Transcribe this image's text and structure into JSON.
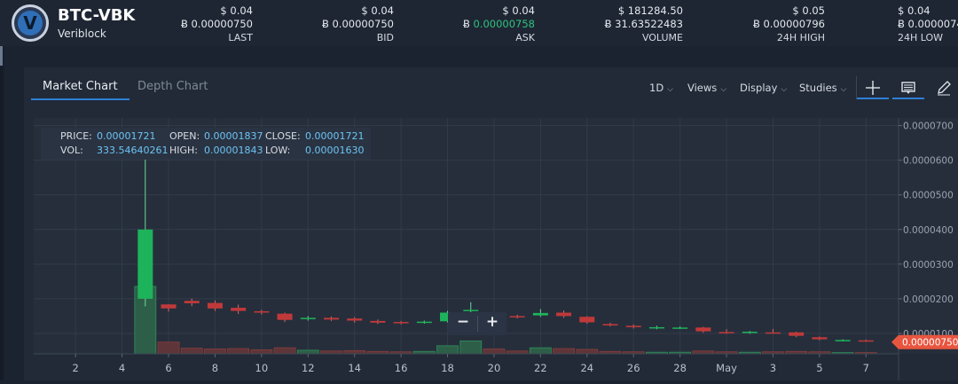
{
  "market": {
    "pair": "BTC-VBK",
    "name": "Veriblock",
    "stats": [
      {
        "usd": "$ 0.04",
        "btc": "0.00000750",
        "label": "LAST",
        "highlight": false
      },
      {
        "usd": "$ 0.04",
        "btc": "0.00000750",
        "label": "BID",
        "highlight": false
      },
      {
        "usd": "$ 0.04",
        "btc": "0.00000758",
        "label": "ASK",
        "highlight": true
      },
      {
        "usd": "$ 181284.50",
        "btc": "31.63522483",
        "label": "VOLUME",
        "highlight": false
      },
      {
        "usd": "$ 0.05",
        "btc": "0.00000796",
        "label": "24H HIGH",
        "highlight": false
      },
      {
        "usd": "$ 0.04",
        "btc": "0.0000074",
        "label": "24H LOW",
        "highlight": false
      }
    ],
    "btc_symbol": "Ƀ"
  },
  "tabs": {
    "market_chart": "Market Chart",
    "depth_chart": "Depth Chart"
  },
  "controls": {
    "interval": "1D",
    "views": "Views",
    "display": "Display",
    "studies": "Studies"
  },
  "icons": {
    "logo": "veriblock-logo-icon",
    "crosshair": "crosshair-icon",
    "indicator": "indicator-panel-icon",
    "draw": "pencil-icon",
    "chevron": "chevron-down-icon",
    "zoom_out": "minus-icon",
    "zoom_in": "plus-icon"
  },
  "zoom": {
    "minus": "−",
    "plus": "+"
  },
  "legend": {
    "price_label": "PRICE:",
    "price": "0.00001721",
    "open_label": "OPEN:",
    "open": "0.00001837",
    "close_label": "CLOSE:",
    "close": "0.00001721",
    "vol_label": "VOL:",
    "vol": "333.54640261",
    "high_label": "HIGH:",
    "high": "0.00001843",
    "low_label": "LOW:",
    "low": "0.00001630"
  },
  "colors": {
    "up": "#1db35a",
    "down": "#c0393a",
    "price_tag": "#e8553f",
    "accent": "#2f7fd6"
  },
  "chart_data": {
    "type": "candlestick",
    "x_ticks": [
      "2",
      "4",
      "6",
      "8",
      "10",
      "12",
      "14",
      "16",
      "18",
      "20",
      "22",
      "24",
      "26",
      "28",
      "May",
      "3",
      "5",
      "7"
    ],
    "x_tick_pos": [
      2,
      4,
      6,
      8,
      10,
      12,
      14,
      16,
      18,
      20,
      22,
      24,
      26,
      28,
      30,
      32,
      34,
      36
    ],
    "x_range": [
      0.2,
      37.4
    ],
    "y_ticks": [
      "0.0000700",
      "0.0000600",
      "0.0000500",
      "0.0000400",
      "0.0000300",
      "0.0000200",
      "0.0000100"
    ],
    "y_tick_values": [
      7e-05,
      6e-05,
      5e-05,
      4e-05,
      3e-05,
      2e-05,
      1e-05
    ],
    "y_range": [
      4.1e-06,
      7.22e-05
    ],
    "last_price": "0.00000750",
    "last_price_value": 7.5e-06,
    "volume_max": 333.55,
    "candles": [
      {
        "x": 5,
        "open": 2e-05,
        "close": 4e-05,
        "high": 6.7e-05,
        "low": 1.78e-05
      },
      {
        "x": 6,
        "open": 1.837e-05,
        "close": 1.721e-05,
        "high": 1.843e-05,
        "low": 1.63e-05
      },
      {
        "x": 7,
        "open": 1.94e-05,
        "close": 1.87e-05,
        "high": 2.01e-05,
        "low": 1.79e-05
      },
      {
        "x": 8,
        "open": 1.88e-05,
        "close": 1.72e-05,
        "high": 1.95e-05,
        "low": 1.65e-05
      },
      {
        "x": 9,
        "open": 1.74e-05,
        "close": 1.65e-05,
        "high": 1.83e-05,
        "low": 1.56e-05
      },
      {
        "x": 10,
        "open": 1.64e-05,
        "close": 1.6e-05,
        "high": 1.68e-05,
        "low": 1.55e-05
      },
      {
        "x": 11,
        "open": 1.57e-05,
        "close": 1.39e-05,
        "high": 1.6e-05,
        "low": 1.33e-05
      },
      {
        "x": 12,
        "open": 1.43e-05,
        "close": 1.45e-05,
        "high": 1.5e-05,
        "low": 1.37e-05
      },
      {
        "x": 13,
        "open": 1.45e-05,
        "close": 1.4e-05,
        "high": 1.49e-05,
        "low": 1.36e-05
      },
      {
        "x": 14,
        "open": 1.43e-05,
        "close": 1.37e-05,
        "high": 1.47e-05,
        "low": 1.31e-05
      },
      {
        "x": 15,
        "open": 1.36e-05,
        "close": 1.31e-05,
        "high": 1.4e-05,
        "low": 1.27e-05
      },
      {
        "x": 16,
        "open": 1.33e-05,
        "close": 1.3e-05,
        "high": 1.36e-05,
        "low": 1.26e-05
      },
      {
        "x": 17,
        "open": 1.31e-05,
        "close": 1.34e-05,
        "high": 1.37e-05,
        "low": 1.28e-05
      },
      {
        "x": 18,
        "open": 1.35e-05,
        "close": 1.6e-05,
        "high": 1.65e-05,
        "low": 1.32e-05
      },
      {
        "x": 19,
        "open": 1.65e-05,
        "close": 1.68e-05,
        "high": 1.9e-05,
        "low": 1.6e-05
      },
      {
        "x": 20,
        "open": 1.5e-05,
        "close": 1.52e-05,
        "high": 1.58e-05,
        "low": 1.4e-05
      },
      {
        "x": 21,
        "open": 1.5e-05,
        "close": 1.48e-05,
        "high": 1.54e-05,
        "low": 1.43e-05
      },
      {
        "x": 22,
        "open": 1.52e-05,
        "close": 1.59e-05,
        "high": 1.7e-05,
        "low": 1.48e-05
      },
      {
        "x": 23,
        "open": 1.6e-05,
        "close": 1.5e-05,
        "high": 1.66e-05,
        "low": 1.45e-05
      },
      {
        "x": 24,
        "open": 1.48e-05,
        "close": 1.32e-05,
        "high": 1.5e-05,
        "low": 1.28e-05
      },
      {
        "x": 25,
        "open": 1.27e-05,
        "close": 1.23e-05,
        "high": 1.31e-05,
        "low": 1.2e-05
      },
      {
        "x": 26,
        "open": 1.22e-05,
        "close": 1.18e-05,
        "high": 1.26e-05,
        "low": 1.14e-05
      },
      {
        "x": 27,
        "open": 1.16e-05,
        "close": 1.18e-05,
        "high": 1.22e-05,
        "low": 1.12e-05
      },
      {
        "x": 28,
        "open": 1.16e-05,
        "close": 1.17e-05,
        "high": 1.2e-05,
        "low": 1.13e-05
      },
      {
        "x": 29,
        "open": 1.17e-05,
        "close": 1.06e-05,
        "high": 1.19e-05,
        "low": 1.02e-05
      },
      {
        "x": 30,
        "open": 1.04e-05,
        "close": 1.02e-05,
        "high": 1.12e-05,
        "low": 9.9e-06
      },
      {
        "x": 31,
        "open": 1.03e-05,
        "close": 1.05e-05,
        "high": 1.07e-05,
        "low": 9.9e-06
      },
      {
        "x": 32,
        "open": 1.03e-05,
        "close": 1.02e-05,
        "high": 1.13e-05,
        "low": 9.9e-06
      },
      {
        "x": 33,
        "open": 1.03e-05,
        "close": 9.3e-06,
        "high": 1.05e-05,
        "low": 8.9e-06
      },
      {
        "x": 34,
        "open": 8.9e-06,
        "close": 8.3e-06,
        "high": 9.1e-06,
        "low": 8e-06
      },
      {
        "x": 35,
        "open": 8e-06,
        "close": 8.1e-06,
        "high": 8.3e-06,
        "low": 7.7e-06
      },
      {
        "x": 36,
        "open": 8e-06,
        "close": 7.8e-06,
        "high": 8.2e-06,
        "low": 7.6e-06
      }
    ],
    "volumes": [
      {
        "x": 5,
        "value": 333.55,
        "up": true
      },
      {
        "x": 6,
        "value": 58,
        "up": false
      },
      {
        "x": 7,
        "value": 28,
        "up": false
      },
      {
        "x": 8,
        "value": 24,
        "up": false
      },
      {
        "x": 9,
        "value": 26,
        "up": false
      },
      {
        "x": 10,
        "value": 20,
        "up": false
      },
      {
        "x": 11,
        "value": 30,
        "up": false
      },
      {
        "x": 12,
        "value": 18,
        "up": true
      },
      {
        "x": 13,
        "value": 14,
        "up": false
      },
      {
        "x": 14,
        "value": 16,
        "up": false
      },
      {
        "x": 15,
        "value": 12,
        "up": false
      },
      {
        "x": 16,
        "value": 10,
        "up": false
      },
      {
        "x": 17,
        "value": 12,
        "up": true
      },
      {
        "x": 18,
        "value": 40,
        "up": true
      },
      {
        "x": 19,
        "value": 64,
        "up": true
      },
      {
        "x": 20,
        "value": 24,
        "up": false
      },
      {
        "x": 21,
        "value": 14,
        "up": false
      },
      {
        "x": 22,
        "value": 30,
        "up": true
      },
      {
        "x": 23,
        "value": 26,
        "up": false
      },
      {
        "x": 24,
        "value": 22,
        "up": false
      },
      {
        "x": 25,
        "value": 12,
        "up": false
      },
      {
        "x": 26,
        "value": 10,
        "up": false
      },
      {
        "x": 27,
        "value": 8,
        "up": true
      },
      {
        "x": 28,
        "value": 8,
        "up": true
      },
      {
        "x": 29,
        "value": 14,
        "up": false
      },
      {
        "x": 30,
        "value": 10,
        "up": false
      },
      {
        "x": 31,
        "value": 8,
        "up": true
      },
      {
        "x": 32,
        "value": 10,
        "up": false
      },
      {
        "x": 33,
        "value": 12,
        "up": false
      },
      {
        "x": 34,
        "value": 10,
        "up": false
      },
      {
        "x": 35,
        "value": 6,
        "up": true
      },
      {
        "x": 36,
        "value": 6,
        "up": false
      }
    ]
  }
}
